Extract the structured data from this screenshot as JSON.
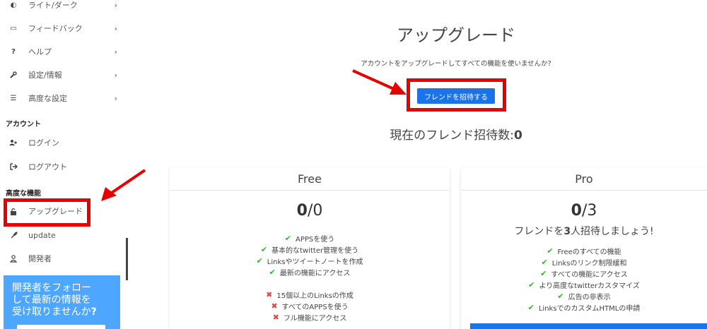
{
  "sidebar": {
    "items": [
      {
        "label": "ライト/ダーク",
        "icon": "half-circle-icon"
      },
      {
        "label": "フィードバック",
        "icon": "chat-bubble-icon"
      },
      {
        "label": "ヘルプ",
        "icon": "question-icon"
      },
      {
        "label": "設定/情報",
        "icon": "wrench-icon"
      },
      {
        "label": "高度な設定",
        "icon": "sliders-icon"
      }
    ],
    "chevron": "›",
    "account_title": "アカウント",
    "account_items": [
      {
        "label": "ログイン",
        "icon": "user-plus-icon"
      },
      {
        "label": "ログアウト",
        "icon": "sign-out-icon"
      }
    ],
    "advanced_title": "高度な機能",
    "advanced_items": [
      {
        "label": "アップグレード",
        "icon": "lock-icon"
      },
      {
        "label": "update",
        "icon": "rocket-icon"
      },
      {
        "label": "開発者",
        "icon": "person-icon"
      }
    ],
    "promo": {
      "line1": "開発者をフォロー",
      "line2": "して最新の情報を",
      "line3": "受け取りませんか",
      "mark": "?"
    }
  },
  "main": {
    "title": "アップグレード",
    "description": "アカウントをアップグレードしてすべての機能を使いませんか?",
    "invite_button": "フレンドを招待する",
    "invite_count_label": "現在のフレンド招待数:",
    "invite_count_value": "0"
  },
  "plans": {
    "free": {
      "name": "Free",
      "count_current": "0",
      "count_total": "/0",
      "included": [
        "APPSを使う",
        "基本的なtwitter管理を使う",
        "Linksやツイートノートを作成",
        "最新の機能にアクセス"
      ],
      "excluded": [
        "15個以上のLinksの作成",
        "すべてのAPPSを使う",
        "フル機能にアクセス"
      ]
    },
    "pro": {
      "name": "Pro",
      "count_current": "0",
      "count_total": "/3",
      "subtitle_pre": "フレンドを",
      "subtitle_num": "3",
      "subtitle_post": "人招待しましょう!",
      "included": [
        "Freeのすべての機能",
        "Linksのリンク制限緩和",
        "すべての機能にアクセス",
        "より高度なtwitterカスタマイズ",
        "広告の非表示",
        "LinksでのカスタムHTMLの申請"
      ]
    }
  },
  "marks": {
    "check": "✔",
    "cross": "✖"
  },
  "colors": {
    "highlight": "#e60000",
    "primary": "#1a73e8",
    "promo": "#4da6ff",
    "check": "#2eb82e",
    "cross": "#e64545"
  }
}
